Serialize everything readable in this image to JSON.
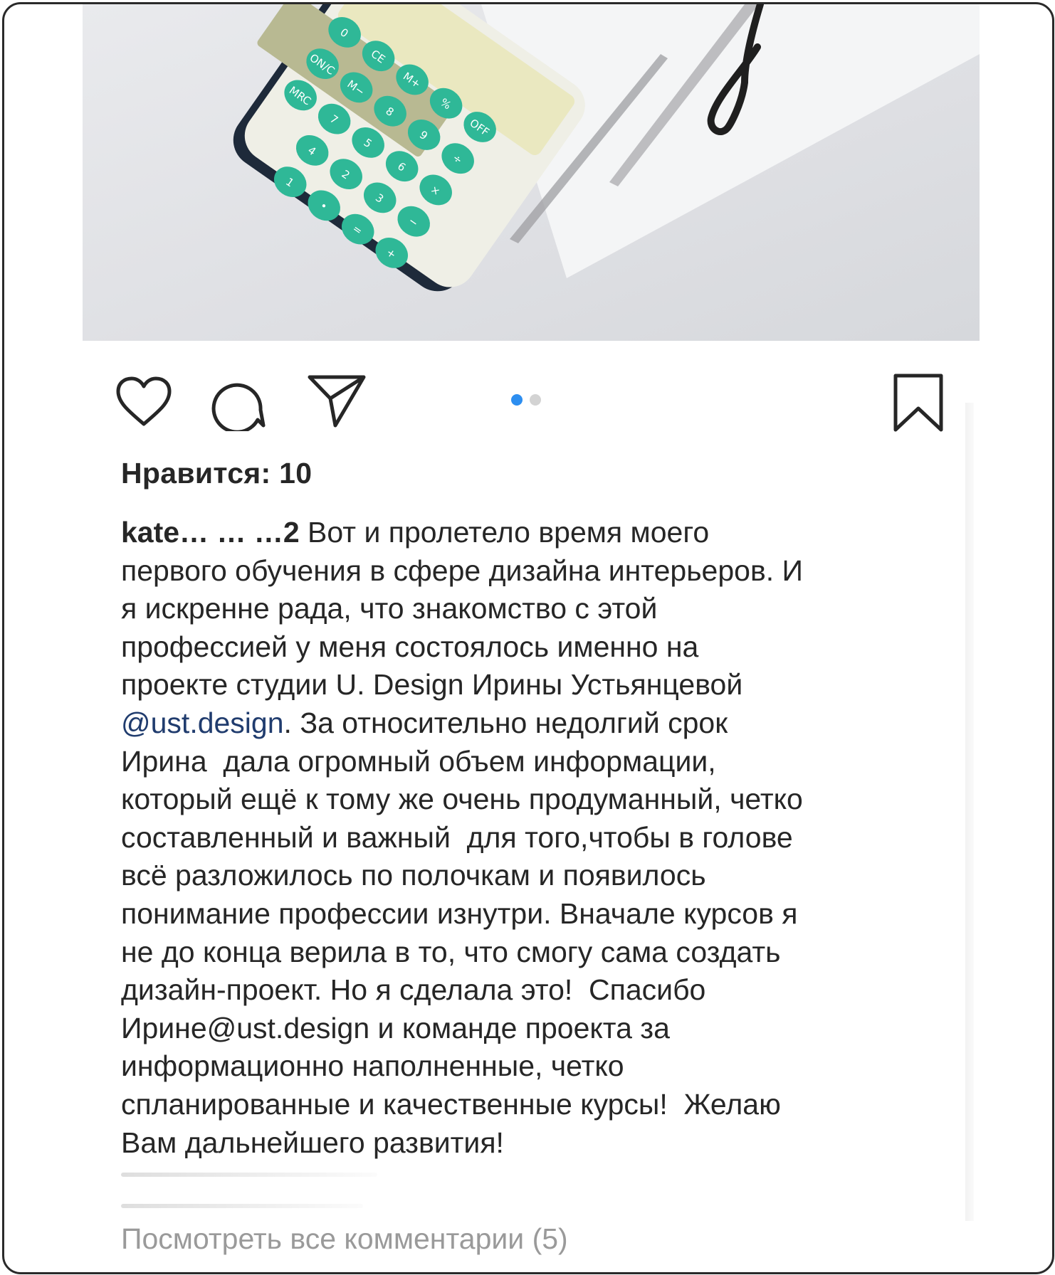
{
  "post": {
    "image": {
      "subject": "calculator-on-paper",
      "calculator_keys": [
        "OFF",
        "÷",
        "×",
        "−",
        "+",
        "%",
        "9",
        "6",
        "3",
        "=",
        "M+",
        "8",
        "5",
        "2",
        "•",
        "CE",
        "M−",
        "7",
        "4",
        "1",
        "0",
        "ON/C",
        "MRC"
      ]
    },
    "actions": {
      "like_icon": "heart-outline-icon",
      "comment_icon": "comment-bubble-icon",
      "share_icon": "paper-plane-icon",
      "save_icon": "bookmark-outline-icon",
      "carousel": {
        "count": 2,
        "active_index": 0,
        "active_color": "#2d8ef0",
        "inactive_color": "#d3d3d3"
      }
    },
    "likes_text": "Нравится: 10",
    "caption": {
      "username": "kate… … …2",
      "lines": [
        " Вот и пролетело время моего",
        "первого обучения в сфере дизайна интерьеров. И",
        "я искренне рада, что знакомство с этой",
        "профессией у меня состоялось именно на",
        "проекте студии U. Design Ирины Устьянцевой"
      ],
      "mention": "@ust.design",
      "mention_tail": ". За относительно недолгий срок",
      "lines_after": [
        "Ирина  дала огромный объем информации,",
        "который ещё к тому же очень продуманный, четко",
        "составленный и важный  для того,чтобы в голове",
        "всё разложилось по полочкам и появилось",
        "понимание профессии изнутри. Вначале курсов я",
        "не до конца верила в то, что смогу сама создать",
        "дизайн-проект. Но я сделала это!  Спасибо",
        "Ирине@ust.design и команде проекта за",
        "информационно наполненные, четко",
        "спланированные и качественные курсы!  Желаю",
        "Вам дальнейшего развития!"
      ]
    },
    "view_all_comments": "Посмотреть все комментарии (5)",
    "colors": {
      "text": "#262626",
      "mention": "#203c6e",
      "muted": "#9a9a9a",
      "calculator_keys": "#2fb897"
    }
  }
}
